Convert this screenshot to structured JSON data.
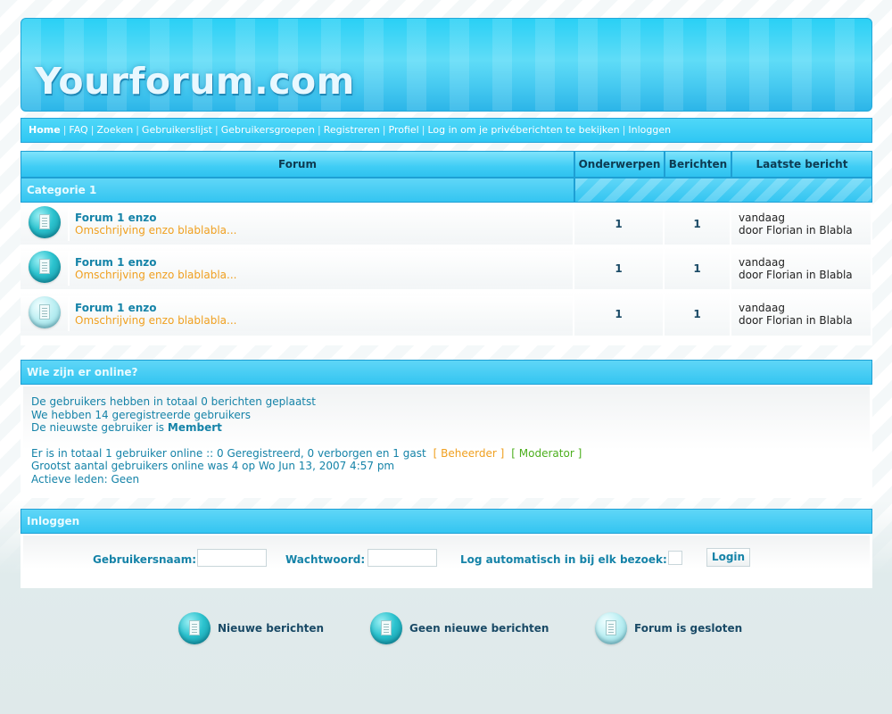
{
  "header": {
    "site_title": "Yourforum.com"
  },
  "nav": {
    "items": [
      {
        "label": "Home"
      },
      {
        "label": "FAQ"
      },
      {
        "label": "Zoeken"
      },
      {
        "label": "Gebruikerslijst"
      },
      {
        "label": "Gebruikersgroepen"
      },
      {
        "label": "Registreren"
      },
      {
        "label": "Profiel"
      },
      {
        "label": "Log in om je privéberichten te bekijken"
      },
      {
        "label": "Inloggen"
      }
    ],
    "separator": "|"
  },
  "forum_table": {
    "columns": [
      "Forum",
      "Onderwerpen",
      "Berichten",
      "Laatste bericht"
    ],
    "category": "Categorie 1",
    "rows": [
      {
        "icon": "new-posts-icon",
        "name": "Forum 1 enzo",
        "description": "Omschrijving enzo blablabla...",
        "topics": "1",
        "posts": "1",
        "last_line1": "vandaag",
        "last_line2": "door Florian in Blabla"
      },
      {
        "icon": "no-new-posts-icon",
        "name": "Forum 1 enzo",
        "description": "Omschrijving enzo blablabla...",
        "topics": "1",
        "posts": "1",
        "last_line1": "vandaag",
        "last_line2": "door Florian in Blabla"
      },
      {
        "icon": "locked-forum-icon",
        "name": "Forum 1 enzo",
        "description": "Omschrijving enzo blablabla...",
        "topics": "1",
        "posts": "1",
        "last_line1": "vandaag",
        "last_line2": "door Florian in Blabla"
      }
    ]
  },
  "online": {
    "title": "Wie zijn er online?",
    "total_posts": "De gebruikers hebben in totaal 0 berichten geplaatst",
    "registered": "We hebben 14 geregistreerde gebruikers",
    "newest_prefix": "De nieuwste gebruiker is",
    "newest_user": "Membert",
    "online_line": "Er is in totaal 1 gebruiker online :: 0 Geregistreerd, 0 verborgen en 1 gast",
    "admin_label": "[ Beheerder ]",
    "moderator_label": "[ Moderator ]",
    "most_online": "Grootst aantal gebruikers online was 4 op Wo Jun 13, 2007 4:57 pm",
    "active_members": "Actieve leden: Geen",
    "admin_color": "#f0a020",
    "moderator_color": "#4caf1d"
  },
  "login": {
    "title": "Inloggen",
    "username_label": "Gebruikersnaam:",
    "username_value": "",
    "password_label": "Wachtwoord:",
    "password_value": "",
    "auto_login_label": "Log automatisch in bij elk bezoek:",
    "auto_login_checked": false,
    "button_label": "Login"
  },
  "legend": [
    {
      "icon": "new-posts-icon",
      "label": "Nieuwe berichten"
    },
    {
      "icon": "no-new-posts-icon",
      "label": "Geen nieuwe berichten"
    },
    {
      "icon": "locked-forum-icon",
      "label": "Forum is gesloten"
    }
  ],
  "colors": {
    "accent": "#34c5f1",
    "link": "#1583a8",
    "description": "#f0a020"
  }
}
